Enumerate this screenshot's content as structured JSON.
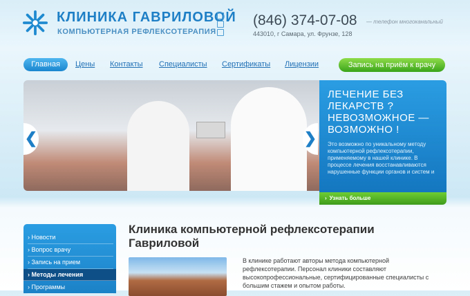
{
  "header": {
    "title": "КЛИНИКА ГАВРИЛОВОЙ",
    "subtitle": "КОМПЬЮТЕРНАЯ РЕФЛЕКСОТЕРАПИЯ",
    "phone": "(846) 374-07-08",
    "phone_note": "— телефон многоканальный",
    "address": "443010, г Самара, ул. Фрунзе, 128"
  },
  "nav": {
    "items": [
      "Главная",
      "Цены",
      "Контакты",
      "Специалисты",
      "Сертификаты",
      "Лицензии"
    ],
    "cta": "Запись на приём к врачу"
  },
  "banner": {
    "promo_title": "ЛЕЧЕНИЕ БЕЗ ЛЕКАРСТВ ? НЕВОЗМОЖНОЕ — ВОЗМОЖНО !",
    "promo_text": "Это возможно по уникальному методу компьютерной рефлексотерапии, применяемому в нашей клинике. В процессе лечения восстанавливаются нарушенные функции органов и систем и",
    "more": "Узнать больше",
    "prev": "❮",
    "next": "❯"
  },
  "sidebar": {
    "items": [
      "Новости",
      "Вопрос врачу",
      "Запись на прием",
      "Методы лечения",
      "Программы"
    ],
    "active_index": 3
  },
  "content": {
    "heading": "Клиника компьютерной рефлексотерапии Гавриловой",
    "text": "В клинике работают авторы метода компьютерной рефлексотерапии. Персонал клиники составляют высокопрофессиональные, сертифицированные специалисты с большим стажем и опытом работы."
  },
  "colors": {
    "brand": "#1f7fc6",
    "cta": "#3aa41a",
    "sidebar_active": "#0f4f88"
  }
}
